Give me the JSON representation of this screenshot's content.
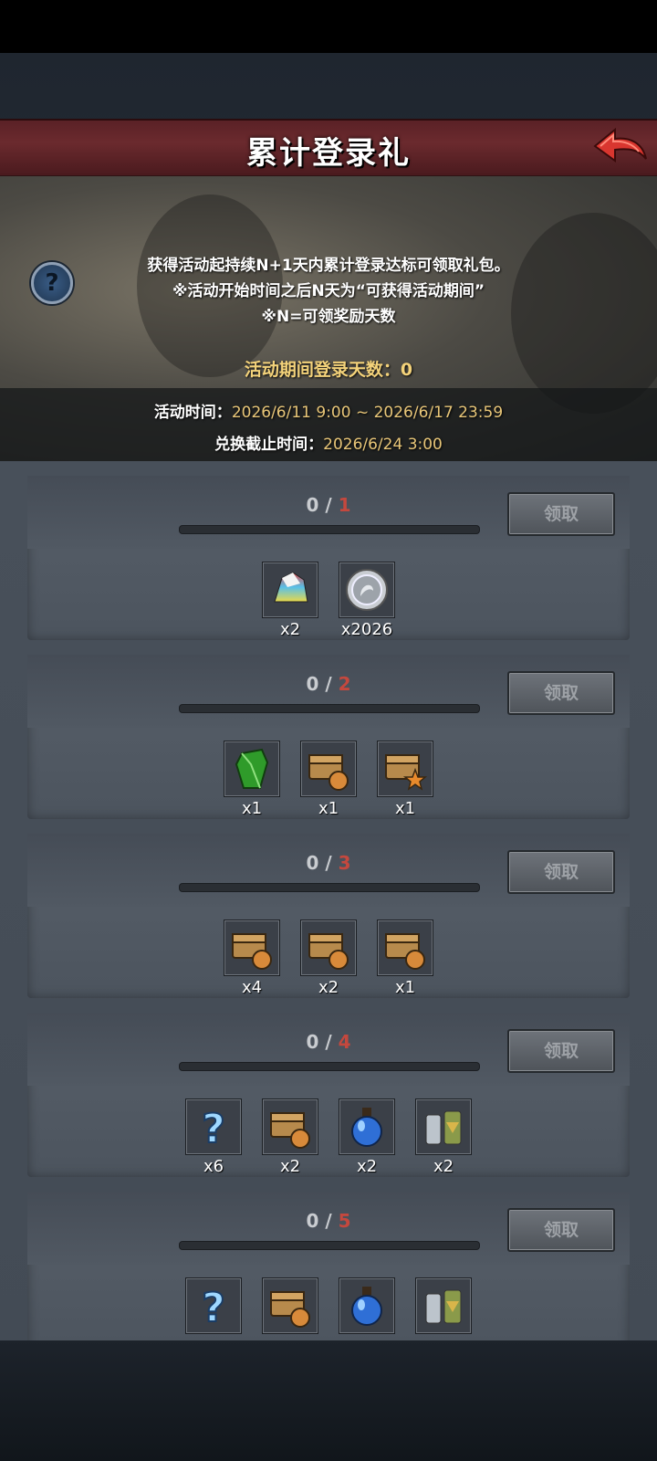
{
  "page": {
    "title": "累计登录礼",
    "description_lines": [
      "获得活动起持续N+1天内累计登录达标可领取礼包。",
      "※活动开始时间之后N天为“可获得活动期间”",
      "※N=可领奖励天数"
    ],
    "login_days_label": "活动期间登录天数：0",
    "activity_time_label": "活动时间：",
    "activity_time_value": "2026/6/11 9:00 ~ 2026/6/17 23:59",
    "redeem_deadline_label": "兑换截止时间：",
    "redeem_deadline_value": "2026/6/24 3:00"
  },
  "rewards": [
    {
      "progress": "0 / ",
      "required": "1",
      "claim_label": "领取",
      "items": [
        {
          "icon": "crystal-rainbow-icon",
          "count": "x2"
        },
        {
          "icon": "silver-coin-icon",
          "count": "x2026"
        }
      ]
    },
    {
      "progress": "0 / ",
      "required": "2",
      "claim_label": "领取",
      "items": [
        {
          "icon": "green-gem-icon",
          "count": "x1"
        },
        {
          "icon": "chest-bag-icon",
          "count": "x1"
        },
        {
          "icon": "chest-star-icon",
          "count": "x1"
        }
      ]
    },
    {
      "progress": "0 / ",
      "required": "3",
      "claim_label": "领取",
      "items": [
        {
          "icon": "chest-bag-icon",
          "count": "x4"
        },
        {
          "icon": "chest-bag-icon",
          "count": "x2"
        },
        {
          "icon": "chest-bag-icon",
          "count": "x1"
        }
      ]
    },
    {
      "progress": "0 / ",
      "required": "4",
      "claim_label": "领取",
      "items": [
        {
          "icon": "mystery-question-icon",
          "count": "x6"
        },
        {
          "icon": "chest-bag-icon",
          "count": "x2"
        },
        {
          "icon": "blue-potion-icon",
          "count": "x2"
        },
        {
          "icon": "bottles-icon",
          "count": "x2"
        }
      ]
    },
    {
      "progress": "0 / ",
      "required": "5",
      "claim_label": "领取",
      "items": [
        {
          "icon": "mystery-question-icon",
          "count": ""
        },
        {
          "icon": "chest-bag-icon",
          "count": ""
        },
        {
          "icon": "blue-potion-icon",
          "count": ""
        },
        {
          "icon": "bottles-icon",
          "count": ""
        }
      ]
    }
  ],
  "colors": {
    "title_bar": "#6b2a2e",
    "required_count": "#c4483e",
    "accent_gold": "#f3d27a",
    "back_arrow": "#d9362f"
  }
}
